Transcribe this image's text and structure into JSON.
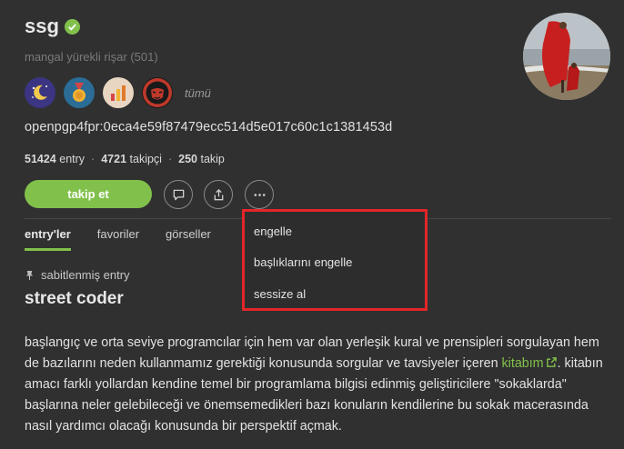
{
  "profile": {
    "username": "ssg",
    "rank": "mangal yürekli rişar (501)",
    "badges": [
      {
        "name": "night-moon-badge",
        "color": "#3b3583"
      },
      {
        "name": "medal-badge",
        "color": "#2b6d96"
      },
      {
        "name": "chart-badge",
        "color": "#e8d6c3"
      },
      {
        "name": "mask-badge",
        "color": "#1a1a1a"
      }
    ],
    "badges_all_label": "tümü",
    "fingerprint": "openpgp4fpr:0eca4e59f87479ecc514d5e017c60c1c1381453d",
    "stats": {
      "entry_count": "51424",
      "entry_label": "entry",
      "followers_count": "4721",
      "followers_label": "takipçi",
      "following_count": "250",
      "following_label": "takip",
      "separator": "·"
    },
    "follow_button": "takip et"
  },
  "tabs": [
    {
      "label": "entry'ler"
    },
    {
      "label": "favoriler"
    },
    {
      "label": "görseller"
    }
  ],
  "menu": {
    "items": [
      {
        "label": "engelle"
      },
      {
        "label": "başlıklarını engelle"
      },
      {
        "label": "sessize al"
      }
    ]
  },
  "entry": {
    "pinned_label": "sabitlenmiş entry",
    "title": "street coder",
    "body_part1": "başlangıç ve orta seviye programcılar için hem var olan yerleşik kural ve prensipleri sorgulayan hem de bazılarını neden kullanmamız gerektiği konusunda sorgular ve tavsiyeler içeren ",
    "link_text": "kitabım",
    "body_part2": ". kitabın amacı farklı yollardan kendine temel bir programlama bilgisi edinmiş geliştiricilere \"sokaklarda\" başlarına neler gelebileceği ve önemsemedikleri bazı konuların kendilerine bu sokak macerasında nasıl yardımcı olacağı konusunda bir perspektif açmak."
  },
  "colors": {
    "accent": "#81c14b",
    "background": "#303030",
    "highlight_border": "#e3262a"
  }
}
